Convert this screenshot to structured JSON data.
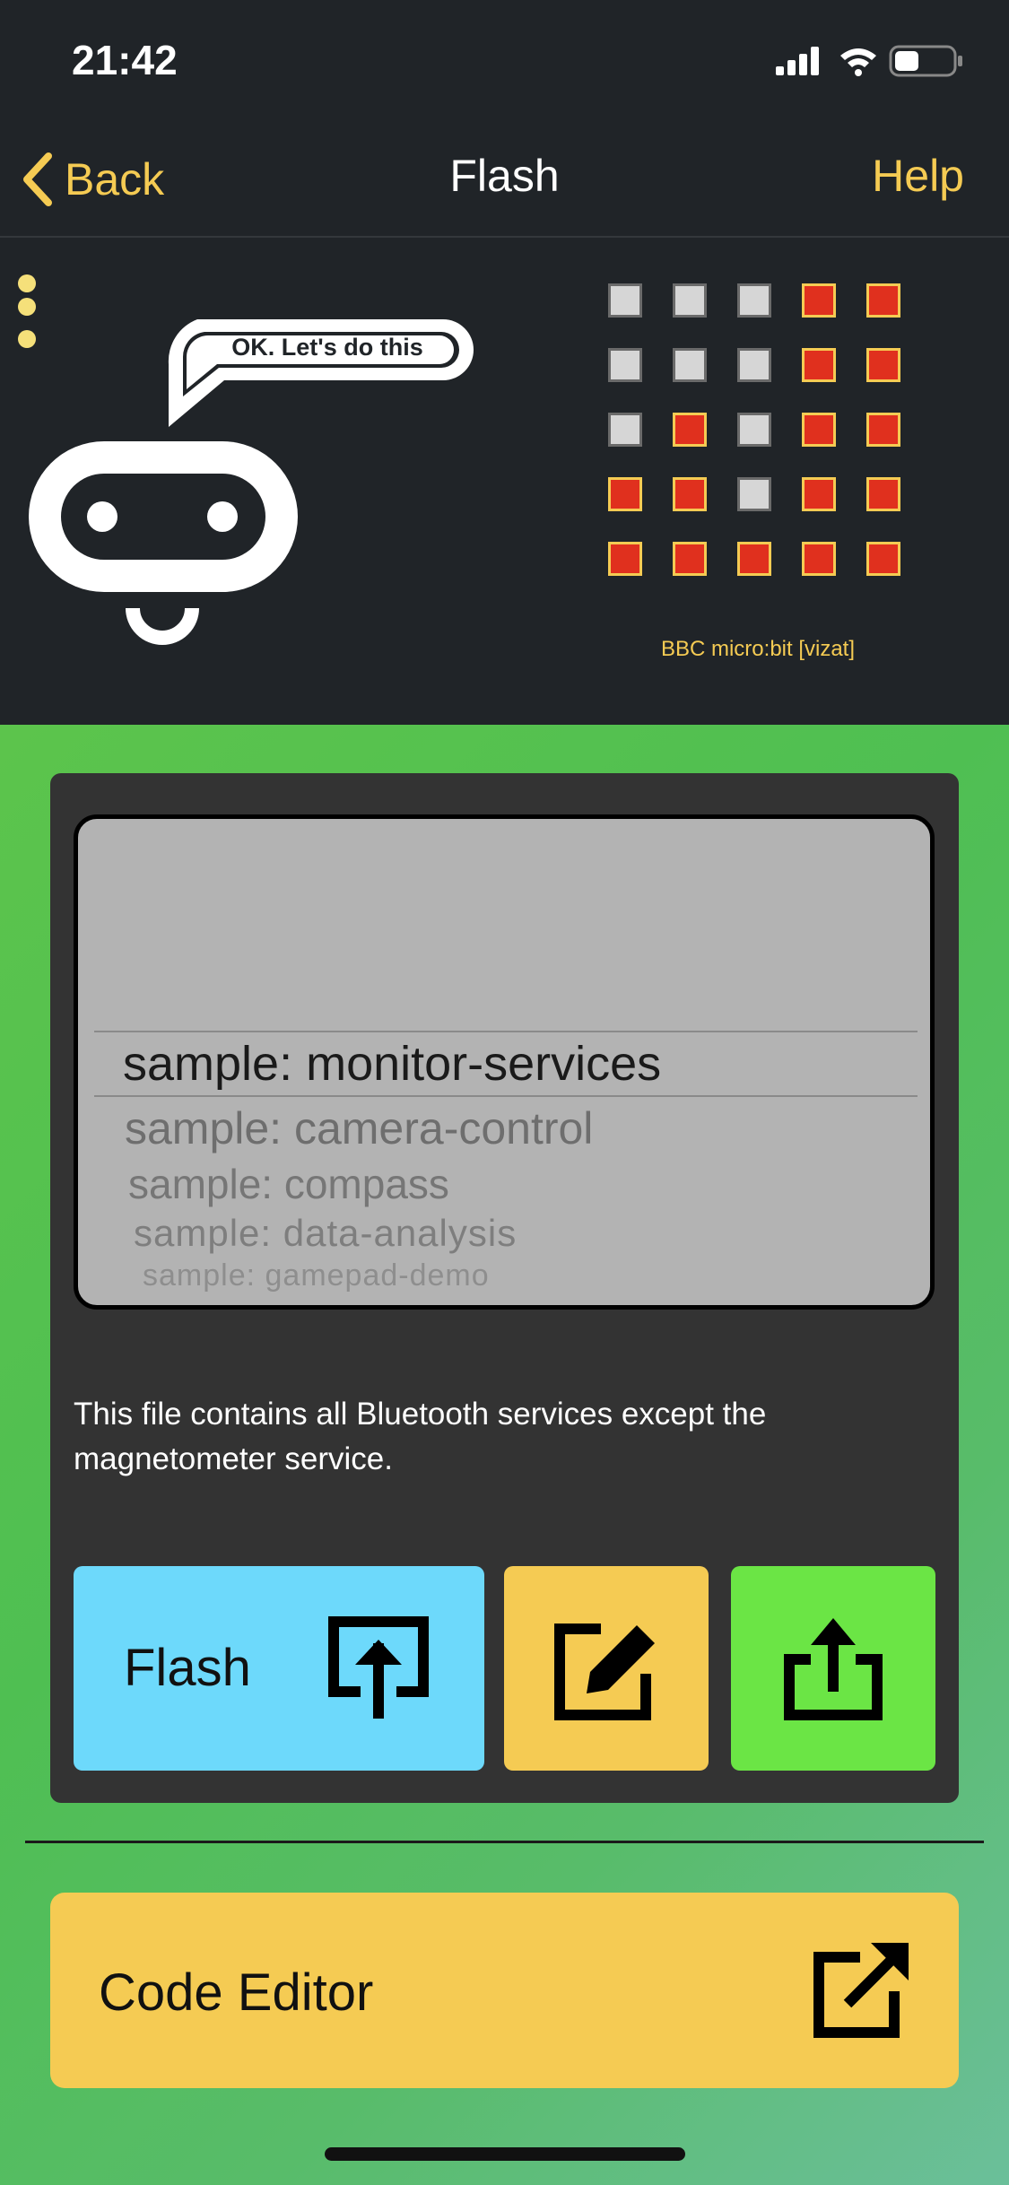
{
  "status_bar": {
    "time": "21:42"
  },
  "nav": {
    "back_label": "Back",
    "title": "Flash",
    "help_label": "Help"
  },
  "header": {
    "speech_text": "OK. Let's do this",
    "device_name": "BBC micro:bit [vizat]",
    "led_matrix": [
      [
        0,
        0,
        0,
        1,
        1
      ],
      [
        0,
        0,
        0,
        1,
        1
      ],
      [
        0,
        1,
        0,
        1,
        1
      ],
      [
        1,
        1,
        0,
        1,
        1
      ],
      [
        1,
        1,
        1,
        1,
        1
      ]
    ]
  },
  "picker": {
    "items": [
      "sample: monitor-services",
      "sample: camera-control",
      "sample: compass",
      "sample: data-analysis",
      "sample: gamepad-demo"
    ],
    "selected": "sample: monitor-services"
  },
  "description": "This file contains all Bluetooth services except the magnetometer service.",
  "actions": {
    "flash_label": "Flash"
  },
  "code_editor": {
    "label": "Code Editor"
  },
  "colors": {
    "accent": "#f5cb53",
    "dark_bg": "#202428",
    "flash_button": "#6dd9fb",
    "share_button": "#6be545",
    "led_on": "#e0301e"
  },
  "icons": {
    "back": "chevron-left-icon",
    "flash": "upload-box-icon",
    "edit": "edit-pencil-icon",
    "share": "share-icon",
    "code_editor": "external-link-icon"
  }
}
